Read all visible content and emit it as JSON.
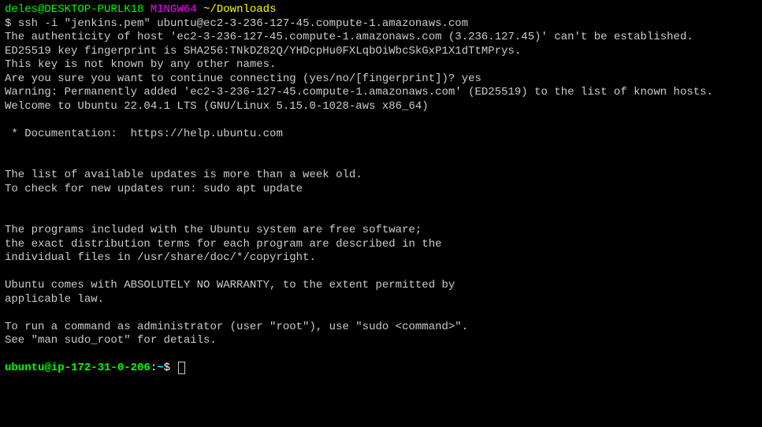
{
  "prompt1": {
    "user_host": "deles@DESKTOP-PURLK18",
    "env": "MINGW64",
    "path": "~/Downloads",
    "symbol": "$",
    "command": "ssh -i \"jenkins.pem\" ubuntu@ec2-3-236-127-45.compute-1.amazonaws.com"
  },
  "output": {
    "line1": "The authenticity of host 'ec2-3-236-127-45.compute-1.amazonaws.com (3.236.127.45)' can't be established.",
    "line2": "ED25519 key fingerprint is SHA256:TNkDZ82Q/YHDcpHu0FXLqbOiWbcSkGxP1X1dTtMPrys.",
    "line3": "This key is not known by any other names.",
    "line4": "Are you sure you want to continue connecting (yes/no/[fingerprint])? yes",
    "line5": "Warning: Permanently added 'ec2-3-236-127-45.compute-1.amazonaws.com' (ED25519) to the list of known hosts.",
    "line6": "Welcome to Ubuntu 22.04.1 LTS (GNU/Linux 5.15.0-1028-aws x86_64)",
    "line7": " * Documentation:  https://help.ubuntu.com",
    "line8": "The list of available updates is more than a week old.",
    "line9": "To check for new updates run: sudo apt update",
    "line10": "The programs included with the Ubuntu system are free software;",
    "line11": "the exact distribution terms for each program are described in the",
    "line12": "individual files in /usr/share/doc/*/copyright.",
    "line13": "Ubuntu comes with ABSOLUTELY NO WARRANTY, to the extent permitted by",
    "line14": "applicable law.",
    "line15": "To run a command as administrator (user \"root\"), use \"sudo <command>\".",
    "line16": "See \"man sudo_root\" for details."
  },
  "prompt2": {
    "user_host": "ubuntu@ip-172-31-0-206",
    "colon": ":",
    "path": "~",
    "symbol": "$"
  }
}
